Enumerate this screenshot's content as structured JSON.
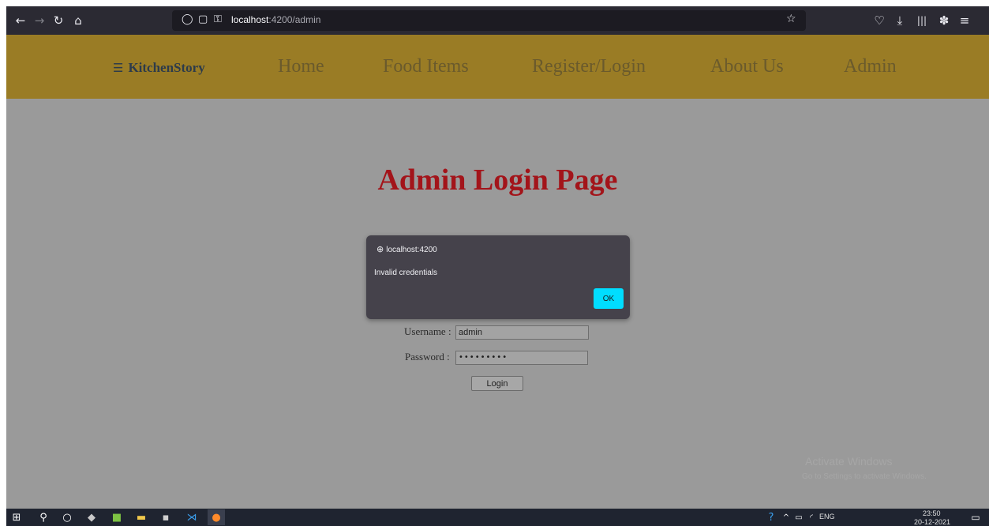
{
  "browser": {
    "url_host": "localhost",
    "url_rest": ":4200/admin",
    "icons": [
      "back-arrow-icon",
      "forward-arrow-icon",
      "reload-icon",
      "home-icon",
      "shield-icon",
      "page-icon",
      "key-icon",
      "star-icon",
      "pocket-icon",
      "download-icon",
      "library-icon",
      "extension-icon",
      "menu-icon"
    ]
  },
  "navbar": {
    "brand": "KitchenStory",
    "links": [
      "Home",
      "Food Items",
      "Register/Login",
      "About Us",
      "Admin"
    ],
    "bg_color": "#9a7c25"
  },
  "page": {
    "title": "Admin Login Page",
    "title_color": "#a3141a",
    "username_label": "Username :",
    "username_value": "admin",
    "password_label": "Password :",
    "password_value": "•••••••••",
    "login_button": "Login"
  },
  "alert": {
    "origin": "localhost:4200",
    "message": "Invalid credentials",
    "ok_label": "OK",
    "ok_color": "#00ddff"
  },
  "watermark": {
    "line1": "Activate Windows",
    "line2": "Go to Settings to activate Windows."
  },
  "taskbar": {
    "language": "ENG",
    "time": "23:50",
    "date": "20-12-2021"
  }
}
